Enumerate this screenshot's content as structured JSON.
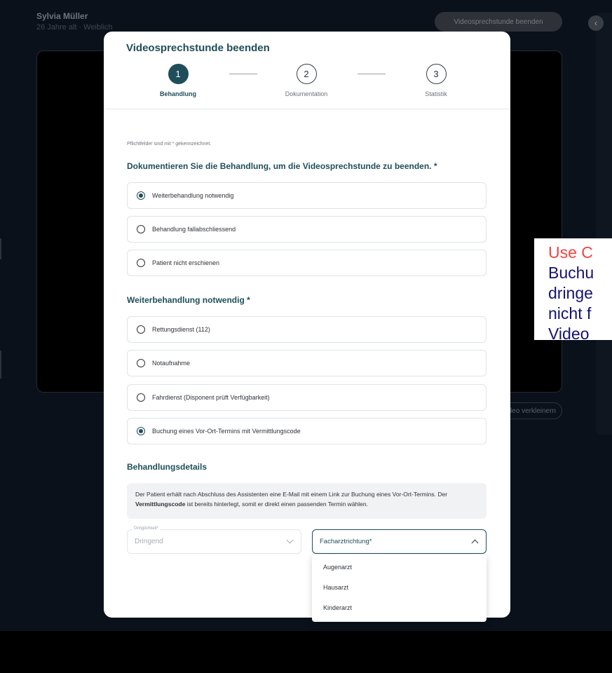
{
  "background": {
    "patient_name": "Sylvia Müller",
    "patient_meta": "26 Jahre alt · Weiblich",
    "end_button": "Videosprechstunde beenden",
    "back_icon": "chevron-left-icon",
    "video_shrink": "Video verkleinern"
  },
  "overlay_note": {
    "line1": "Use C",
    "line2": "Buchu",
    "line3": "dringe",
    "line4": "nicht f",
    "line5": "Video"
  },
  "modal": {
    "title": "Videosprechstunde beenden",
    "steps": [
      {
        "number": "1",
        "label": "Behandlung",
        "active": true
      },
      {
        "number": "2",
        "label": "Dokumentation",
        "active": false
      },
      {
        "number": "3",
        "label": "Statistik",
        "active": false
      }
    ],
    "required_hint": "Pflichtfelder sind mit * gekennzeichnet.",
    "section_documentation": "Dokumentieren Sie die Behandlung, um die Videosprechstunde zu beenden. *",
    "options_treatment": [
      {
        "label": "Weiterbehandlung notwendig",
        "checked": true
      },
      {
        "label": "Behandlung fallabschliessend",
        "checked": false
      },
      {
        "label": "Patient nicht erschienen",
        "checked": false
      }
    ],
    "section_followup": "Weiterbehandlung notwendig *",
    "options_followup": [
      {
        "label": "Rettungsdienst (112)",
        "checked": false
      },
      {
        "label": "Notaufnahme",
        "checked": false
      },
      {
        "label": "Fahrdienst (Disponent prüft Verfügbarkeit)",
        "checked": false
      },
      {
        "label": "Buchung eines Vor-Ort-Termins mit Vermittlungscode",
        "checked": true
      }
    ],
    "section_details": "Behandlungsdetails",
    "info_text_before": "Der Patient erhält nach Abschluss des Assistenten eine E-Mail mit einem Link zur Buchung eines Vor-Ort-Termins. Der ",
    "info_text_bold": "Vermittlungscode",
    "info_text_after": " ist bereits hinterlegt, somit er direkt einen passenden Termin wählen.",
    "urgency_label": "Dringlichkeit*",
    "urgency_value": "Dringend",
    "specialty_placeholder": "Facharztrichtung*",
    "specialty_options": [
      "Augenarzt",
      "Hausarzt",
      "Kinderarzt"
    ]
  },
  "colors": {
    "primary": "#1f4e5a",
    "backdrop": "#0b111a",
    "overlay_red": "#ef4444",
    "overlay_navy": "#15136e"
  }
}
